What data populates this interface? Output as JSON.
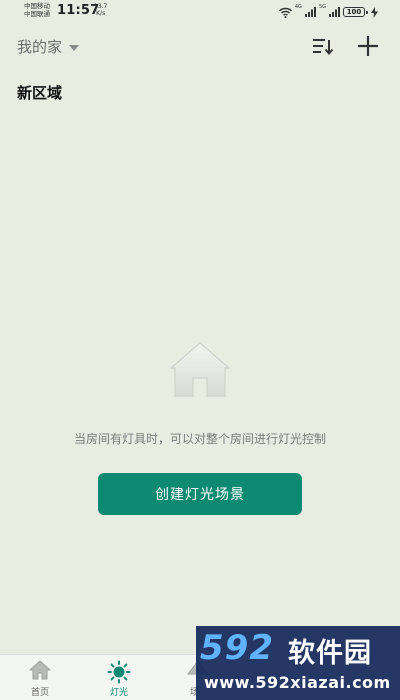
{
  "status_bar": {
    "carrier_1": "中国移动",
    "carrier_2": "中国联通",
    "time": "11:57",
    "net_speed_value": "13.7",
    "net_speed_unit": "K/s",
    "signal_label_1": "4G",
    "signal_label_2": "5G",
    "battery": "100"
  },
  "header": {
    "home_name": "我的家"
  },
  "section": {
    "title": "新区域"
  },
  "empty_state": {
    "message": "当房间有灯具时，可以对整个房间进行灯光控制",
    "button_label": "创建灯光场景"
  },
  "bottom_nav": {
    "items": [
      {
        "label": "首页",
        "icon": "home-icon",
        "active": false
      },
      {
        "label": "灯光",
        "icon": "sun-icon",
        "active": true
      },
      {
        "label": "场",
        "icon": "scene-icon",
        "active": false
      }
    ]
  },
  "watermark": {
    "logo": "592",
    "name": "软件园",
    "url": "www.592xiazai.com"
  },
  "colors": {
    "background": "#e9ede1",
    "accent": "#0f8a72",
    "nav_background": "#f4f6f2"
  }
}
